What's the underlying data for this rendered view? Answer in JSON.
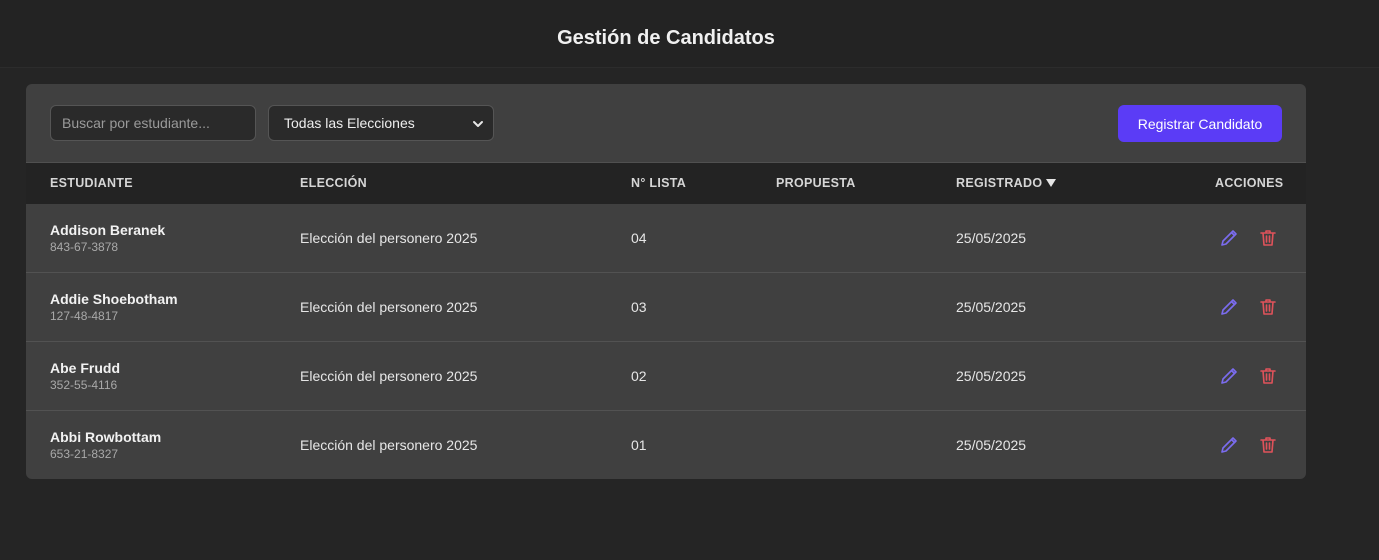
{
  "header": {
    "title": "Gestión de Candidatos"
  },
  "toolbar": {
    "search_placeholder": "Buscar por estudiante...",
    "election_select": {
      "selected": "Todas las Elecciones"
    },
    "register_label": "Registrar Candidato"
  },
  "table": {
    "columns": [
      "ESTUDIANTE",
      "ELECCIÓN",
      "N° LISTA",
      "PROPUESTA",
      "REGISTRADO",
      "ACCIONES"
    ],
    "sort_indicator": "sort-desc-icon",
    "rows": [
      {
        "name": "Addison Beranek",
        "doc": "843-67-3878",
        "election": "Elección del personero 2025",
        "list": "04",
        "proposal": "",
        "registered": "25/05/2025"
      },
      {
        "name": "Addie Shoebotham",
        "doc": "127-48-4817",
        "election": "Elección del personero 2025",
        "list": "03",
        "proposal": "",
        "registered": "25/05/2025"
      },
      {
        "name": "Abe Frudd",
        "doc": "352-55-4116",
        "election": "Elección del personero 2025",
        "list": "02",
        "proposal": "",
        "registered": "25/05/2025"
      },
      {
        "name": "Abbi Rowbottam",
        "doc": "653-21-8327",
        "election": "Elección del personero 2025",
        "list": "01",
        "proposal": "",
        "registered": "25/05/2025"
      }
    ]
  },
  "colors": {
    "accent": "#5b3cf6",
    "edit": "#7b6cf0",
    "delete": "#e0525a",
    "background": "#252525",
    "card": "#404040"
  },
  "icons": {
    "edit": "pencil-icon",
    "delete": "trash-icon",
    "select": "chevron-down-icon"
  }
}
